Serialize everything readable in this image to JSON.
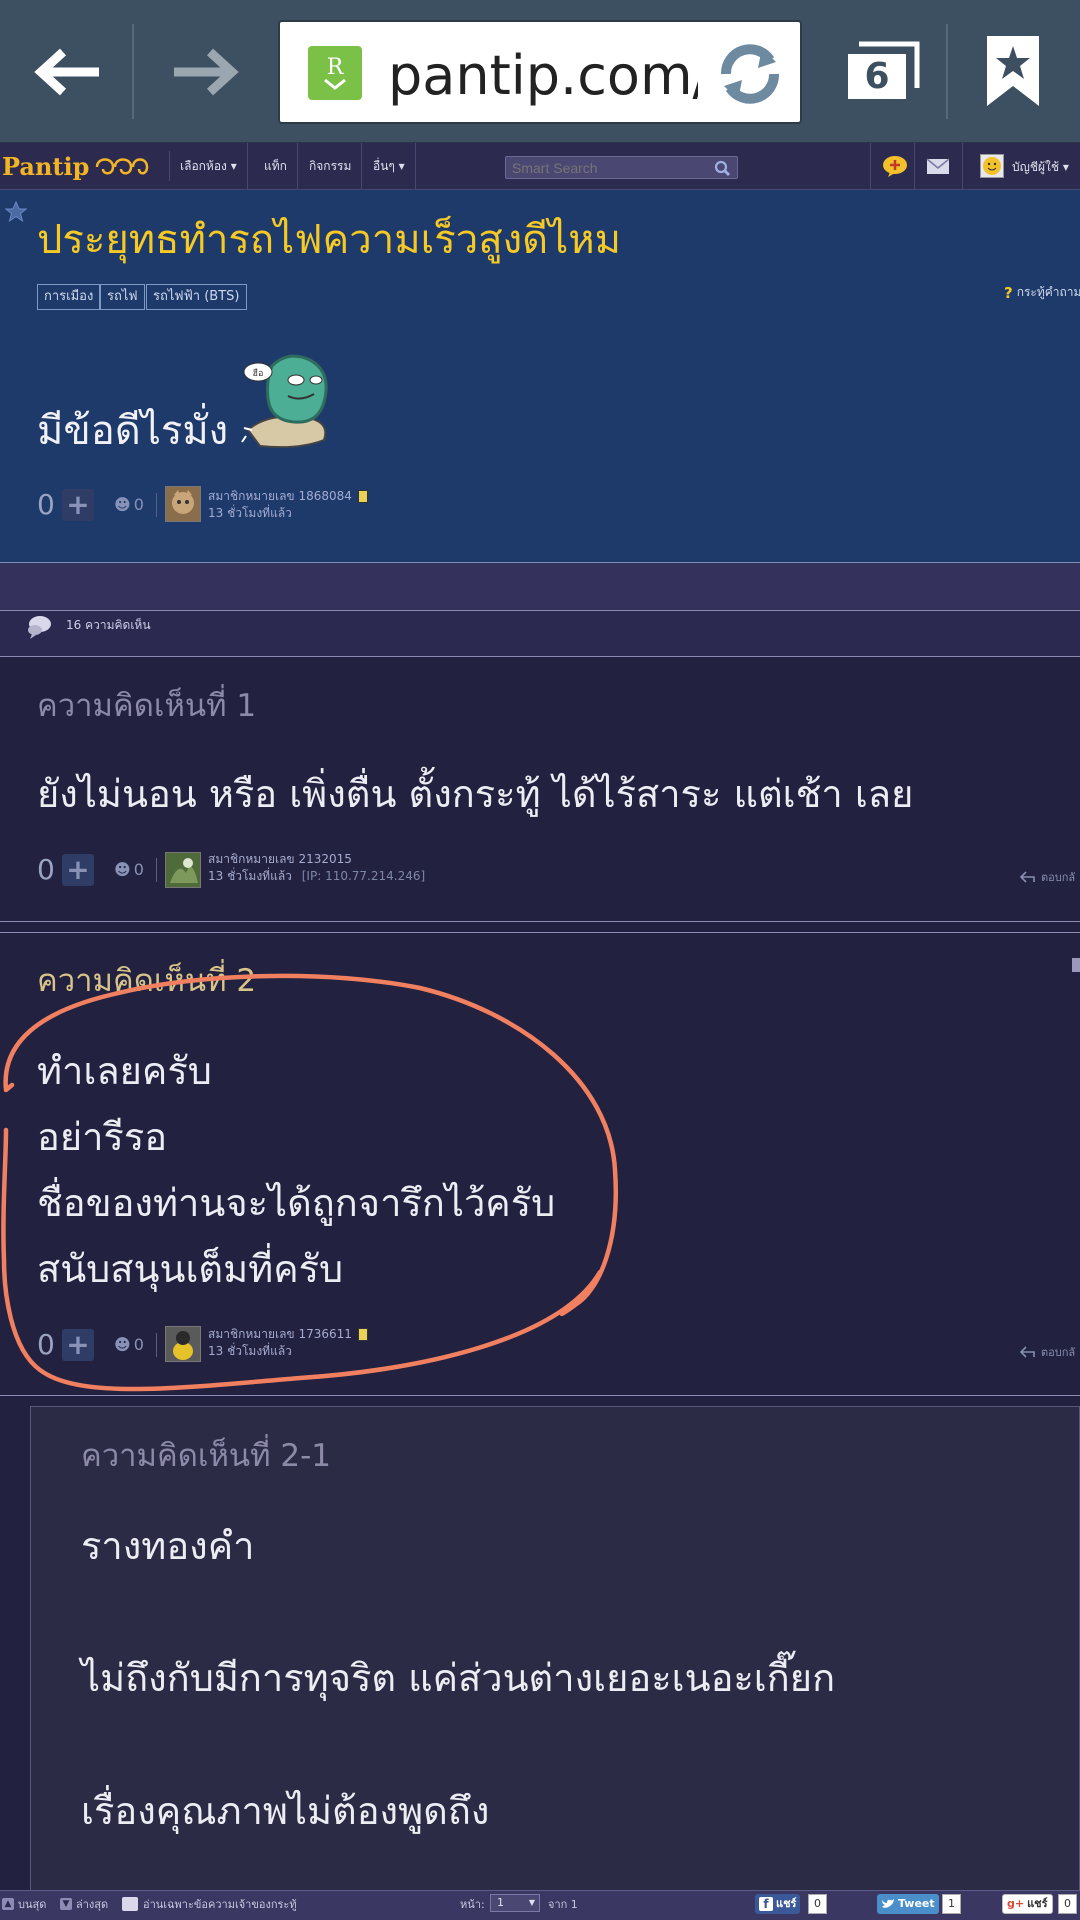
{
  "browser": {
    "url": "pantip.com/t",
    "tab_count": "6"
  },
  "nav": {
    "logo": "Pantip",
    "items": [
      "เลือกห้อง ▾",
      "แท็ก",
      "กิจกรรม",
      "อื่นๆ ▾"
    ],
    "search_placeholder": "Smart Search",
    "account": "บัญชีผู้ใช้ ▾"
  },
  "topic": {
    "title": "ประยุทธทำรถไฟความเร็วสูงดีไหม",
    "tags": [
      "การเมือง",
      "รถไฟ",
      "รถไฟฟ้า (BTS)"
    ],
    "help": "กระทู้คำถาม",
    "body": "มีข้อดีไรมั่ง",
    "votes": "0",
    "emotions": "0",
    "member": "สมาชิกหมายเลข 1868084",
    "time": "13 ชั่วโมงที่แล้ว"
  },
  "comment_count": "16 ความคิดเห็น",
  "comments": [
    {
      "header": "ความคิดเห็นที่ 1",
      "lines": [
        "ยังไม่นอน  หรือ เพิ่งตื่น ตั้งกระทู้ ได้ไร้สาระ แต่เช้า เลย"
      ],
      "votes": "0",
      "emotions": "0",
      "member": "สมาชิกหมายเลข 2132015",
      "time": "13 ชั่วโมงที่แล้ว",
      "ip": "[IP: 110.77.214.246]",
      "reply": "ตอบกลั"
    },
    {
      "header": "ความคิดเห็นที่ 2",
      "lines": [
        "ทำเลยครับ",
        "อย่ารีรอ",
        "ชื่อของท่านจะได้ถูกจารึกไว้ครับ",
        "สนับสนุนเต็มที่ครับ"
      ],
      "votes": "0",
      "emotions": "0",
      "member": "สมาชิกหมายเลข 1736611",
      "time": "13 ชั่วโมงที่แล้ว",
      "reply": "ตอบกลั"
    }
  ],
  "subcomment": {
    "header": "ความคิดเห็นที่ 2-1",
    "lines": [
      "รางทองคำ",
      "ไม่ถึงกับมีการทุจริต แค่ส่วนต่างเยอะเนอะเกี๊ยก",
      "เรื่องคุณภาพไม่ต้องพูดถึง"
    ]
  },
  "bottom_bar": {
    "top": "บนสุด",
    "bottom": "ล่างสุด",
    "owner_only": "อ่านเฉพาะข้อความเจ้าของกระทู้",
    "page_label": "หน้า:",
    "page_value": "1",
    "page_of": "จาก 1",
    "fb_share": "แชร์",
    "fb_count": "0",
    "tweet": "Tweet",
    "tweet_count": "1",
    "gplus_share": "แชร์",
    "gplus_count": "0"
  },
  "colors": {
    "annotation_circle": "#f08060",
    "topic_title": "#f6c925",
    "topic_bg": "#1d3a6b",
    "page_bg": "#22213f"
  }
}
